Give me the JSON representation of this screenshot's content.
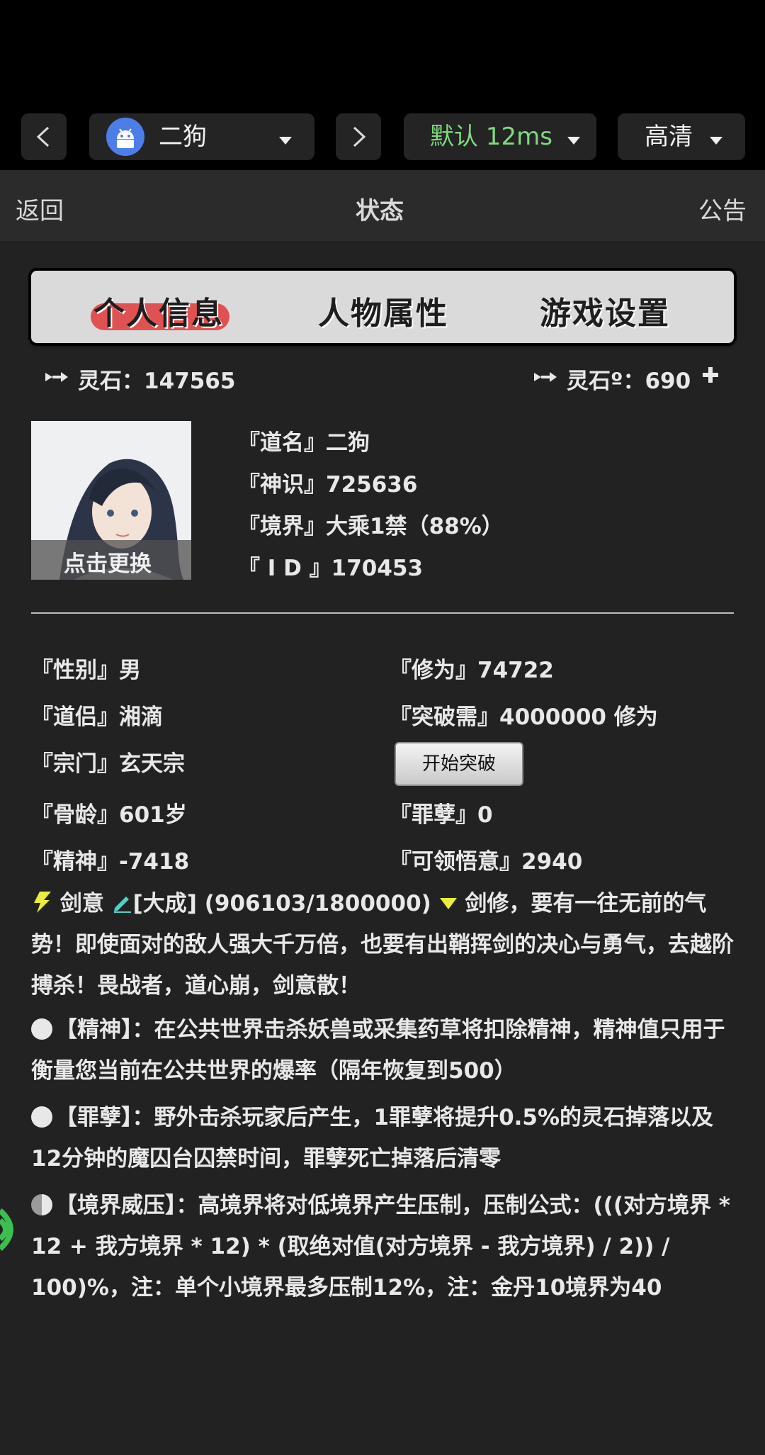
{
  "toolbar": {
    "back_icon": "chevron-left-icon",
    "account": {
      "name": "二狗",
      "icon": "android-icon"
    },
    "forward_icon": "chevron-right-icon",
    "latency": "默认 12ms",
    "quality": "高清"
  },
  "nav": {
    "back": "返回",
    "title": "状态",
    "notice": "公告"
  },
  "tabs": [
    "个人信息",
    "人物属性",
    "游戏设置"
  ],
  "currency": {
    "spirit_stones": "灵石：147565",
    "premium_stones": "灵石º：690"
  },
  "profile": {
    "change_avatar": "点击更换",
    "name": "『道名』二狗",
    "divine_sense": "『神识』725636",
    "realm": "『境界』大乘1禁（88%）",
    "id": "『 I D 』170453"
  },
  "attributes": {
    "gender": "『性别』男",
    "cultivation": "『修为』74722",
    "partner": "『道侣』湘滴",
    "breakthrough_need": "『突破需』4000000 修为",
    "sect": "『宗门』玄天宗",
    "breakthrough_button": "开始突破",
    "bone_age": "『骨龄』601岁",
    "sin": "『罪孽』0",
    "spirit": "『精神』-7418",
    "insight": "『可领悟意』2940"
  },
  "sword_intent": {
    "label": "剑意",
    "level": "[大成]",
    "progress": "(906103/1800000)",
    "desc": "剑修，要有一往无前的气势！即使面对的敌人强大千万倍，也要有出鞘挥剑的决心与勇气，去越阶搏杀！畏战者，道心崩，剑意散！"
  },
  "notes": [
    {
      "text": "【精神】：在公共世界击杀妖兽或采集药草将扣除精神，精神值只用于衡量您当前在公共世界的爆率（隔年恢复到500）"
    },
    {
      "text": "【罪孽】：野外击杀玩家后产生，1罪孽将提升0.5%的灵石掉落以及12分钟的魔囚台囚禁时间，罪孽死亡掉落后清零"
    },
    {
      "text": "【境界威压】：高境界将对低境界产生压制，压制公式：(((对方境界 * 12 + 我方境界 * 12) * (取绝对值(对方境界 - 我方境界) / 2)) / 100)%，注：单个小境界最多压制12%，注：金丹10境界为40"
    }
  ],
  "colors": {
    "background": "#222222",
    "highlight": "#ecec3c",
    "tab_active": "#e05252",
    "latency_text": "#7fd97f"
  }
}
